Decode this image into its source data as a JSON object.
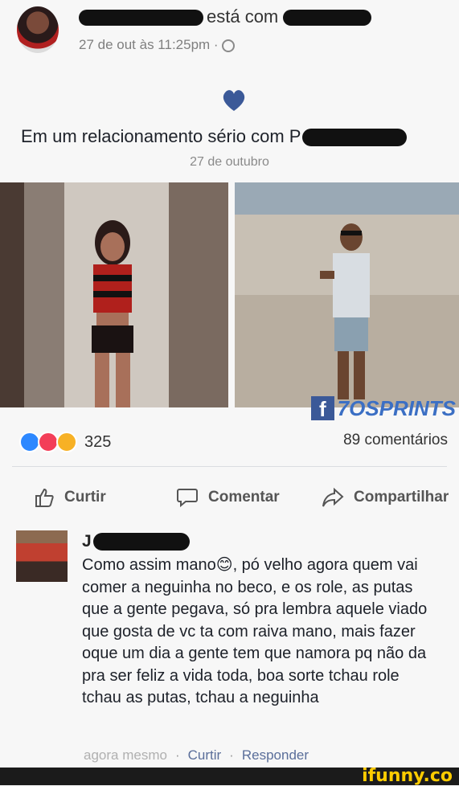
{
  "post": {
    "header": {
      "status_text": "está com",
      "timestamp": "27 de out às 11:25pm ·"
    },
    "event": {
      "title": "Em um relacionamento sério com P",
      "date": "27 de outubro"
    },
    "watermark": "7OSPRINTS",
    "reactions": {
      "count": "325",
      "comments": "89 comentários"
    },
    "actions": {
      "like": "Curtir",
      "comment": "Comentar",
      "share": "Compartilhar"
    },
    "colors": {
      "heart": "#3b5998",
      "link": "#5a6e9a",
      "ifunny": "#ffcc00"
    }
  },
  "comment": {
    "name_initial": "J",
    "text": "Como assim mano😊, pó velho agora quem vai comer a neguinha no beco, e os role, as putas que a gente pegava, só pra lembra aquele viado que gosta de vc ta com raiva mano, mais fazer oque um dia a gente tem que namora pq não da pra ser feliz a vida toda, boa sorte tchau role tchau as putas, tchau a neguinha",
    "time": "agora mesmo",
    "like": "Curtir",
    "reply": "Responder"
  },
  "footer": {
    "brand": "ifunny.co"
  }
}
